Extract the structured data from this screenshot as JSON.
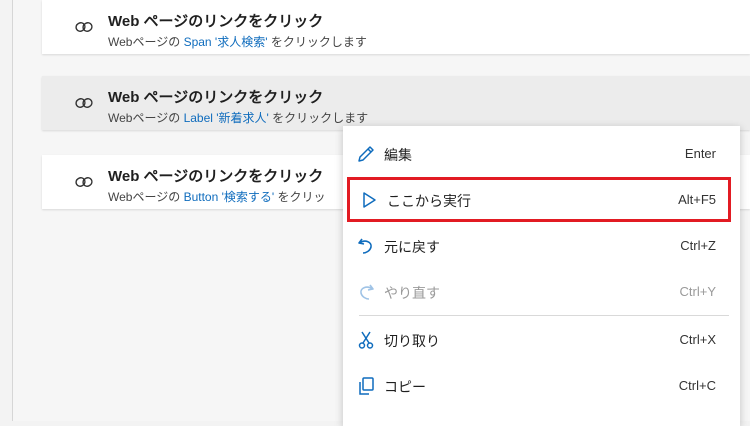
{
  "steps": [
    {
      "title": "Web ページのリンクをクリック",
      "desc_prefix": "Webページの ",
      "param": "Span '求人検索'",
      "desc_suffix": " をクリックします"
    },
    {
      "title": "Web ページのリンクをクリック",
      "desc_prefix": "Webページの ",
      "param": "Label '新着求人'",
      "desc_suffix": " をクリックします"
    },
    {
      "title": "Web ページのリンクをクリック",
      "desc_prefix": "Webページの ",
      "param": "Button '検索する'",
      "desc_suffix": " をクリッ"
    }
  ],
  "context_menu": {
    "items": [
      {
        "label": "編集",
        "shortcut": "Enter",
        "icon": "pencil-icon"
      },
      {
        "label": "ここから実行",
        "shortcut": "Alt+F5",
        "icon": "play-icon"
      },
      {
        "label": "元に戻す",
        "shortcut": "Ctrl+Z",
        "icon": "undo-icon"
      },
      {
        "label": "やり直す",
        "shortcut": "Ctrl+Y",
        "icon": "redo-icon"
      },
      {
        "label": "切り取り",
        "shortcut": "Ctrl+X",
        "icon": "scissors-icon"
      },
      {
        "label": "コピー",
        "shortcut": "Ctrl+C",
        "icon": "copy-icon"
      }
    ]
  },
  "colors": {
    "highlight_border": "#e21b23",
    "link_param": "#0f6cbd",
    "icon_blue": "#0f6cbd"
  }
}
